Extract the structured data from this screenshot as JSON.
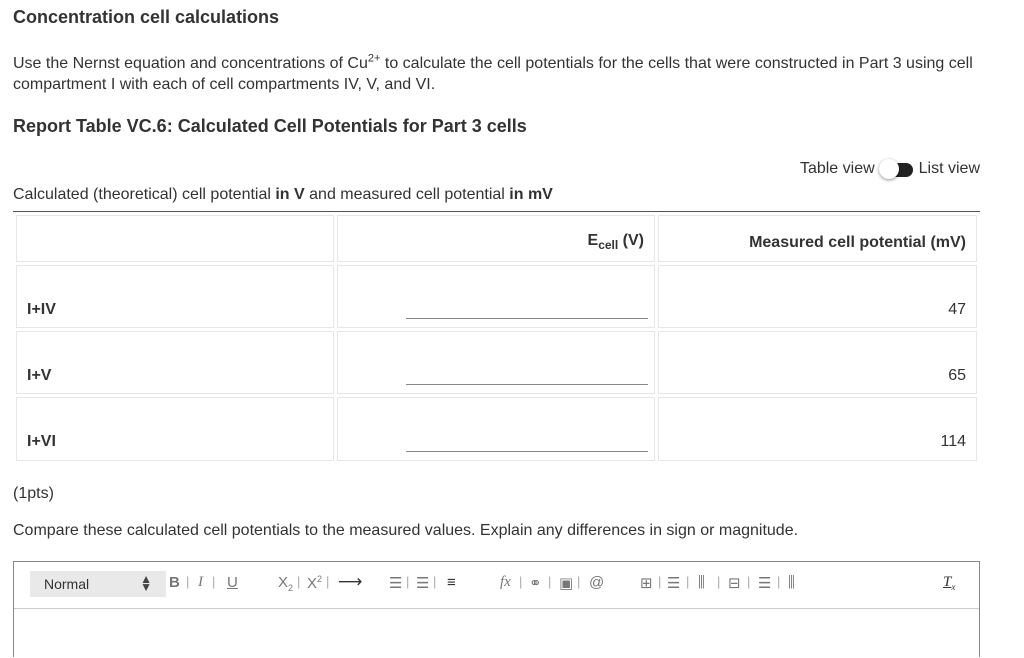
{
  "section_title": "Concentration cell calculations",
  "intro": {
    "text_before": "Use the Nernst equation and concentrations of Cu",
    "superscript": "2+",
    "text_after": " to calculate the cell potentials for the cells that were constructed in Part 3 using cell compartment I with each of cell compartments IV, V, and VI."
  },
  "report_title": "Report Table VC.6: Calculated Cell Potentials for Part 3 cells",
  "view_toggle": {
    "left_label": "Table view",
    "right_label": "List view"
  },
  "caption": {
    "part1": "Calculated (theoretical) cell potential ",
    "bold1": "in V",
    "part2": " and measured cell potential ",
    "bold2": "in mV"
  },
  "table": {
    "header": {
      "ecell_main": "E",
      "ecell_sub": "cell",
      "ecell_unit": " (V)",
      "measured": "Measured cell potential (mV)"
    },
    "rows": [
      {
        "label": "I+IV",
        "ecell_value": "",
        "measured": "47"
      },
      {
        "label": "I+V",
        "ecell_value": "",
        "measured": "65"
      },
      {
        "label": "I+VI",
        "ecell_value": "",
        "measured": "114"
      }
    ]
  },
  "points": "(1pts)",
  "prompt": "Compare these calculated cell potentials to the measured values. Explain any differences in sign or magnitude.",
  "editor": {
    "format_value": "Normal",
    "toolbar_icons": [
      "bold-icon",
      "italic-icon",
      "underline-icon",
      "subscript-icon",
      "superscript-icon",
      "arrow-icon",
      "ordered-list-icon",
      "bullet-list-icon",
      "align-icon",
      "formula-icon",
      "link-icon",
      "image-icon",
      "attach-icon",
      "table-icon",
      "insert-row-icon",
      "insert-col-icon",
      "delete-table-icon",
      "delete-row-icon",
      "delete-col-icon",
      "clear-format-icon"
    ]
  }
}
